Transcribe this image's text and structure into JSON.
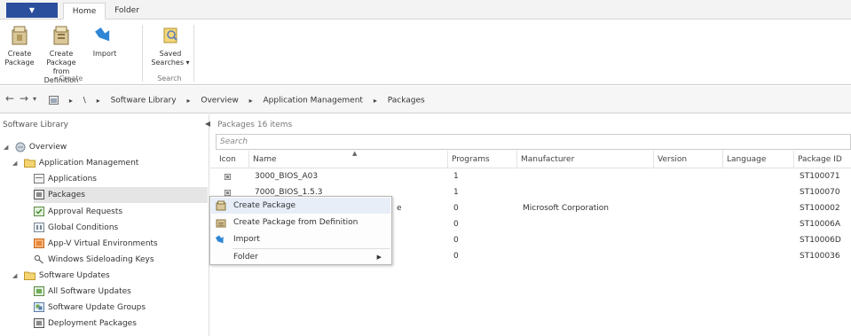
{
  "tabs": {
    "home": "Home",
    "folder": "Folder"
  },
  "ribbon": {
    "create_package": [
      "Create",
      "Package"
    ],
    "create_from_definition": [
      "Create Package",
      "from Definition"
    ],
    "import": [
      "Import"
    ],
    "saved_searches": [
      "Saved",
      "Searches ▾"
    ],
    "group_create": "Create",
    "group_search": "Search"
  },
  "breadcrumb": [
    "\\",
    "Software Library",
    "Overview",
    "Application Management",
    "Packages"
  ],
  "nav": {
    "title": "Software Library",
    "items": [
      {
        "label": "Overview",
        "icon": "overview-icon"
      },
      {
        "label": "Application Management",
        "icon": "folder-icon"
      },
      {
        "label": "Applications",
        "icon": "application-icon"
      },
      {
        "label": "Packages",
        "icon": "package-icon"
      },
      {
        "label": "Approval Requests",
        "icon": "approval-icon"
      },
      {
        "label": "Global Conditions",
        "icon": "conditions-icon"
      },
      {
        "label": "App-V Virtual Environments",
        "icon": "appv-icon"
      },
      {
        "label": "Windows Sideloading Keys",
        "icon": "key-icon"
      },
      {
        "label": "Software Updates",
        "icon": "folder-icon"
      },
      {
        "label": "All Software Updates",
        "icon": "updates-icon"
      },
      {
        "label": "Software Update Groups",
        "icon": "update-groups-icon"
      },
      {
        "label": "Deployment Packages",
        "icon": "package-icon"
      }
    ]
  },
  "packages": {
    "header": "Packages 16 items",
    "search_placeholder": "Search",
    "columns": [
      "Icon",
      "Name",
      "Programs",
      "Manufacturer",
      "Version",
      "Language",
      "Package ID"
    ],
    "rows": [
      {
        "name": "3000_BIOS_A03",
        "programs": "1",
        "manufacturer": "",
        "version": "",
        "language": "",
        "id": "ST100071"
      },
      {
        "name": "7000_BIOS_1.5.3",
        "programs": "1",
        "manufacturer": "",
        "version": "",
        "language": "",
        "id": "ST100070"
      },
      {
        "name": "e",
        "programs": "0",
        "manufacturer": "Microsoft Corporation",
        "version": "",
        "language": "",
        "id": "ST100002"
      },
      {
        "name": "",
        "programs": "0",
        "manufacturer": "",
        "version": "",
        "language": "",
        "id": "ST10006A"
      },
      {
        "name": "",
        "programs": "0",
        "manufacturer": "",
        "version": "",
        "language": "",
        "id": "ST10006D"
      },
      {
        "name": "",
        "programs": "0",
        "manufacturer": "",
        "version": "",
        "language": "",
        "id": "ST100036"
      }
    ]
  },
  "context_menu": {
    "create_package": "Create Package",
    "create_from_definition": "Create Package from Definition",
    "import": "Import",
    "folder": "Folder"
  }
}
